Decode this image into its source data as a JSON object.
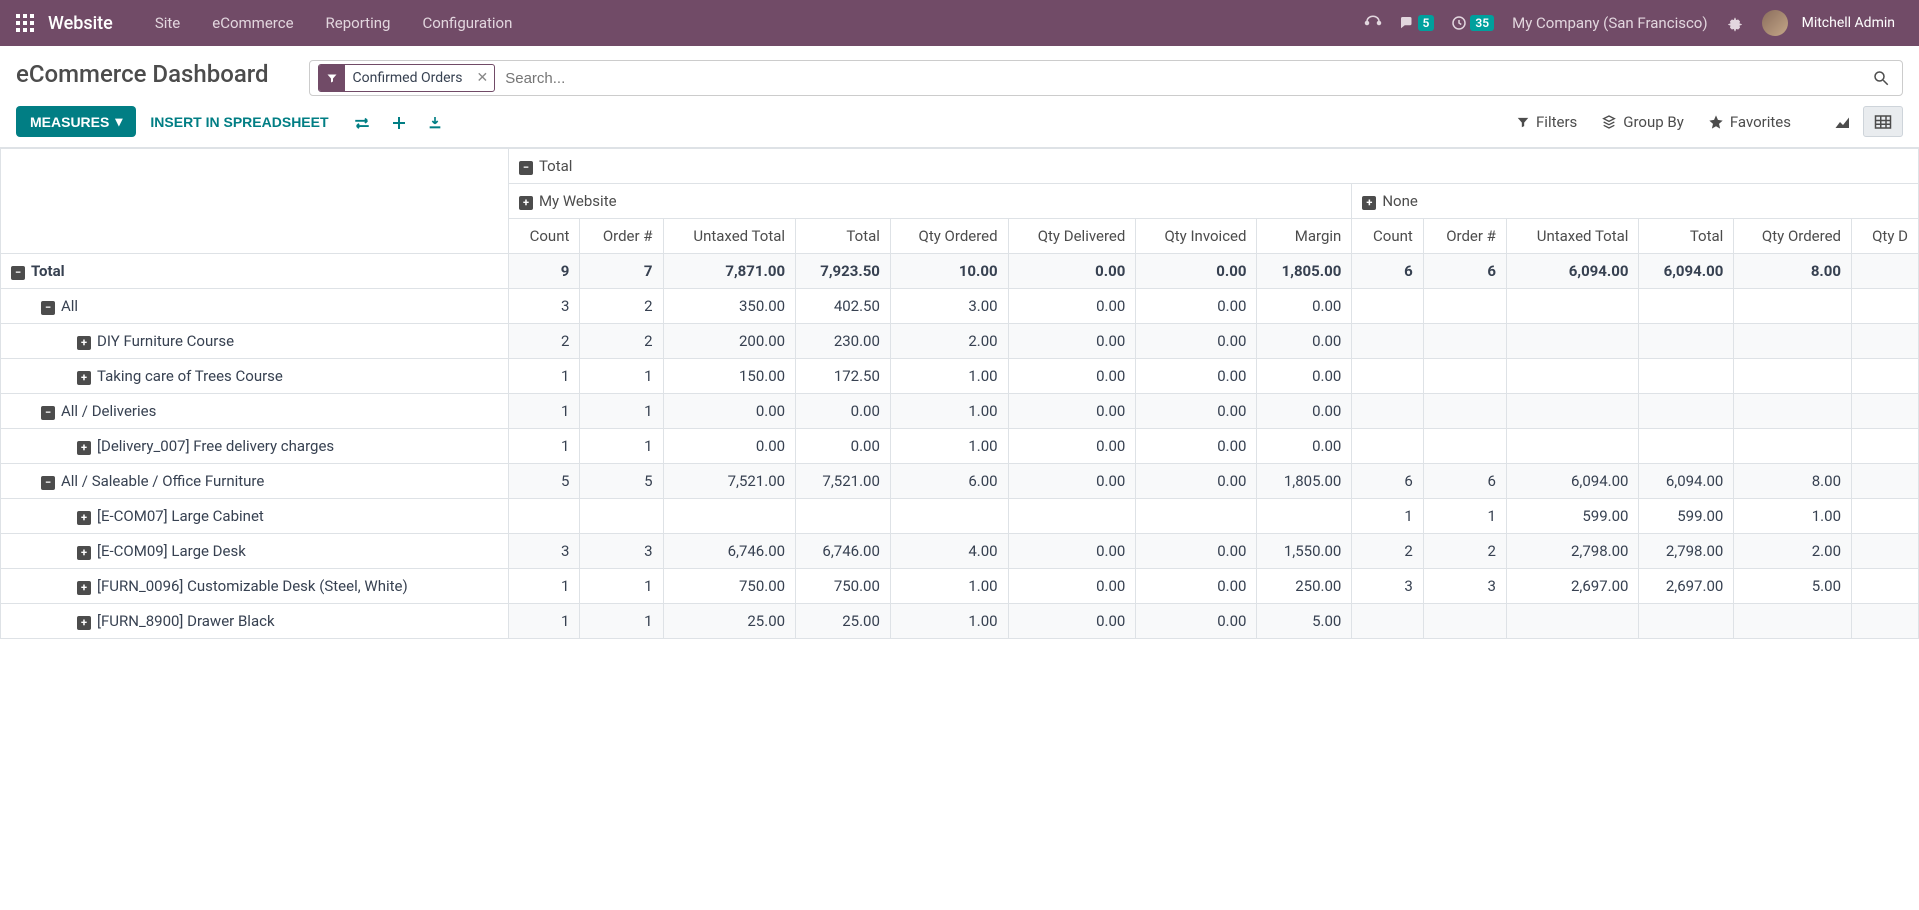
{
  "topnav": {
    "brand": "Website",
    "links": [
      "Site",
      "eCommerce",
      "Reporting",
      "Configuration"
    ],
    "conversations_badge": "5",
    "activities_badge": "35",
    "company": "My Company (San Francisco)",
    "user": "Mitchell Admin"
  },
  "control": {
    "title": "eCommerce Dashboard",
    "facet_label": "Confirmed Orders",
    "search_placeholder": "Search..."
  },
  "toolbar": {
    "measures": "MEASURES",
    "insert_spreadsheet": "INSERT IN SPREADSHEET",
    "filters": "Filters",
    "group_by": "Group By",
    "favorites": "Favorites"
  },
  "pivot": {
    "total_label": "Total",
    "groups": [
      "My Website",
      "None"
    ],
    "measures": [
      "Count",
      "Order #",
      "Untaxed Total",
      "Total",
      "Qty Ordered",
      "Qty Delivered",
      "Qty Invoiced",
      "Margin"
    ],
    "measures_partial": [
      "Count",
      "Order #",
      "Untaxed Total",
      "Total",
      "Qty Ordered",
      "Qty D"
    ],
    "rows": [
      {
        "label": "Total",
        "expanded": true,
        "indent": 0,
        "bold": true,
        "vals": [
          "9",
          "7",
          "7,871.00",
          "7,923.50",
          "10.00",
          "0.00",
          "0.00",
          "1,805.00",
          "6",
          "6",
          "6,094.00",
          "6,094.00",
          "8.00",
          ""
        ]
      },
      {
        "label": "All",
        "expanded": true,
        "indent": 1,
        "vals": [
          "3",
          "2",
          "350.00",
          "402.50",
          "3.00",
          "0.00",
          "0.00",
          "0.00",
          "",
          "",
          "",
          "",
          "",
          ""
        ]
      },
      {
        "label": "DIY Furniture Course",
        "expanded": false,
        "indent": 2,
        "vals": [
          "2",
          "2",
          "200.00",
          "230.00",
          "2.00",
          "0.00",
          "0.00",
          "0.00",
          "",
          "",
          "",
          "",
          "",
          ""
        ]
      },
      {
        "label": "Taking care of Trees Course",
        "expanded": false,
        "indent": 2,
        "vals": [
          "1",
          "1",
          "150.00",
          "172.50",
          "1.00",
          "0.00",
          "0.00",
          "0.00",
          "",
          "",
          "",
          "",
          "",
          ""
        ]
      },
      {
        "label": "All / Deliveries",
        "expanded": true,
        "indent": 1,
        "vals": [
          "1",
          "1",
          "0.00",
          "0.00",
          "1.00",
          "0.00",
          "0.00",
          "0.00",
          "",
          "",
          "",
          "",
          "",
          ""
        ]
      },
      {
        "label": "[Delivery_007] Free delivery charges",
        "expanded": false,
        "indent": 2,
        "vals": [
          "1",
          "1",
          "0.00",
          "0.00",
          "1.00",
          "0.00",
          "0.00",
          "0.00",
          "",
          "",
          "",
          "",
          "",
          ""
        ]
      },
      {
        "label": "All / Saleable / Office Furniture",
        "expanded": true,
        "indent": 1,
        "vals": [
          "5",
          "5",
          "7,521.00",
          "7,521.00",
          "6.00",
          "0.00",
          "0.00",
          "1,805.00",
          "6",
          "6",
          "6,094.00",
          "6,094.00",
          "8.00",
          ""
        ]
      },
      {
        "label": "[E-COM07] Large Cabinet",
        "expanded": false,
        "indent": 2,
        "vals": [
          "",
          "",
          "",
          "",
          "",
          "",
          "",
          "",
          "1",
          "1",
          "599.00",
          "599.00",
          "1.00",
          ""
        ]
      },
      {
        "label": "[E-COM09] Large Desk",
        "expanded": false,
        "indent": 2,
        "vals": [
          "3",
          "3",
          "6,746.00",
          "6,746.00",
          "4.00",
          "0.00",
          "0.00",
          "1,550.00",
          "2",
          "2",
          "2,798.00",
          "2,798.00",
          "2.00",
          ""
        ]
      },
      {
        "label": "[FURN_0096] Customizable Desk (Steel, White)",
        "expanded": false,
        "indent": 2,
        "vals": [
          "1",
          "1",
          "750.00",
          "750.00",
          "1.00",
          "0.00",
          "0.00",
          "250.00",
          "3",
          "3",
          "2,697.00",
          "2,697.00",
          "5.00",
          ""
        ]
      },
      {
        "label": "[FURN_8900] Drawer Black",
        "expanded": false,
        "indent": 2,
        "vals": [
          "1",
          "1",
          "25.00",
          "25.00",
          "1.00",
          "0.00",
          "0.00",
          "5.00",
          "",
          "",
          "",
          "",
          "",
          ""
        ]
      }
    ]
  }
}
